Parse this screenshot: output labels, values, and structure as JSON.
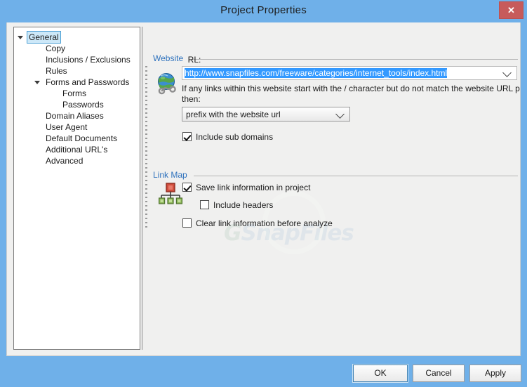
{
  "window": {
    "title": "Project Properties",
    "close_label": "✕",
    "close_icon": "close-icon"
  },
  "tree": {
    "items": [
      {
        "label": "General",
        "indent": 0,
        "expander": "open",
        "selected": true
      },
      {
        "label": "Copy",
        "indent": 1,
        "expander": "none",
        "selected": false
      },
      {
        "label": "Inclusions / Exclusions",
        "indent": 1,
        "expander": "none",
        "selected": false
      },
      {
        "label": "Rules",
        "indent": 1,
        "expander": "none",
        "selected": false
      },
      {
        "label": "Forms and Passwords",
        "indent": 1,
        "expander": "open",
        "selected": false
      },
      {
        "label": "Forms",
        "indent": 2,
        "expander": "none",
        "selected": false
      },
      {
        "label": "Passwords",
        "indent": 2,
        "expander": "none",
        "selected": false
      },
      {
        "label": "Domain Aliases",
        "indent": 1,
        "expander": "none",
        "selected": false
      },
      {
        "label": "User Agent",
        "indent": 1,
        "expander": "none",
        "selected": false
      },
      {
        "label": "Default Documents",
        "indent": 1,
        "expander": "none",
        "selected": false
      },
      {
        "label": "Additional URL's",
        "indent": 1,
        "expander": "none",
        "selected": false
      },
      {
        "label": "Advanced",
        "indent": 1,
        "expander": "none",
        "selected": false
      }
    ]
  },
  "website": {
    "group_title": "Website",
    "url_label": "URL:",
    "url_value": "http://www.snapfiles.com/freeware/categories/internet_tools/index.html",
    "url_selected": true,
    "hint_line1": "If any links within this website start with the / character but do not match the website URL path",
    "hint_line2": "then:",
    "prefix_option": "prefix with the website url",
    "include_subdomains_label": "Include sub domains",
    "include_subdomains_checked": true,
    "globe_icon": "globe-link-icon"
  },
  "linkmap": {
    "group_title": "Link Map",
    "map_icon": "sitemap-icon",
    "save_link_info_label": "Save link information in project",
    "save_link_info_checked": true,
    "include_headers_label": "Include headers",
    "include_headers_checked": false,
    "clear_link_info_label": "Clear link information before analyze",
    "clear_link_info_checked": false
  },
  "watermark": {
    "prefix": "G",
    "text": "SnapFiles"
  },
  "footer": {
    "ok_label": "OK",
    "cancel_label": "Cancel",
    "apply_label": "Apply"
  },
  "colors": {
    "window_chrome": "#6fb0e9",
    "close_button": "#c75b5b",
    "group_title": "#2f72bd",
    "selection_highlight": "#3399ff",
    "tree_selection_bg": "#cde8f8",
    "tree_selection_border": "#4a9fd4",
    "client_bg": "#f0f0ef",
    "default_button_border": "#3c7fb1"
  }
}
